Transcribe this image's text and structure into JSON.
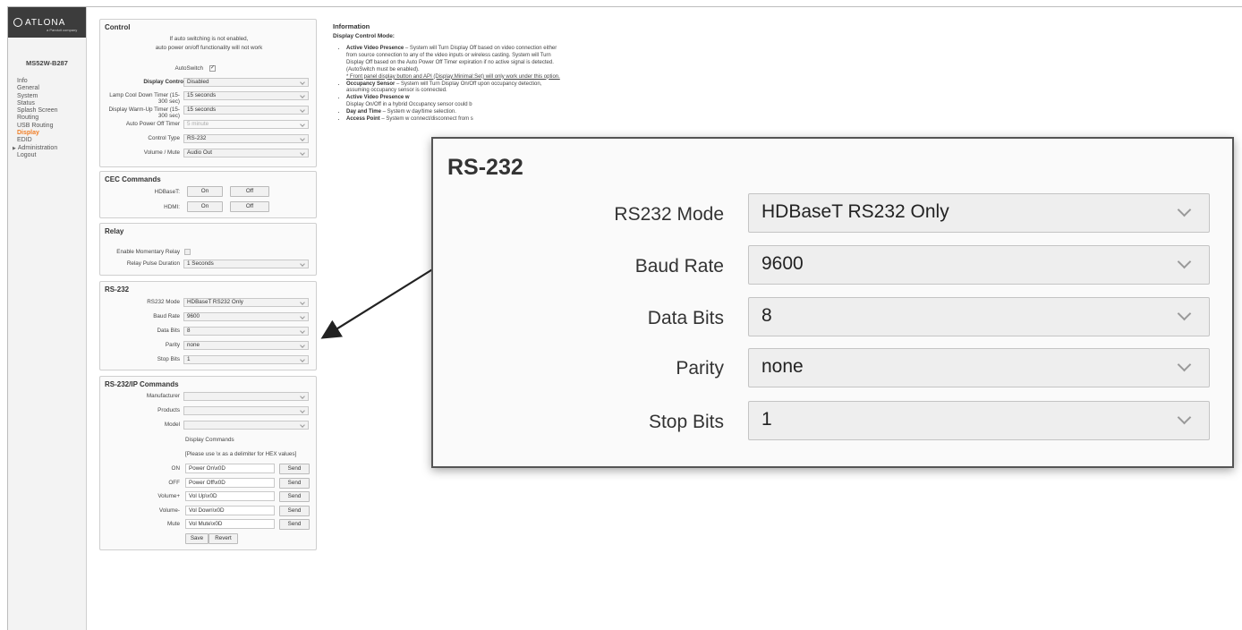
{
  "brand": {
    "logo": "ATLONA",
    "tagline": "a Panduit company"
  },
  "sidebar": {
    "model": "MS52W-B287",
    "items": [
      {
        "label": "Info"
      },
      {
        "label": "General"
      },
      {
        "label": "System"
      },
      {
        "label": "Status"
      },
      {
        "label": "Splash Screen"
      },
      {
        "label": "Routing"
      },
      {
        "label": "USB Routing"
      },
      {
        "label": "Display",
        "active": true
      },
      {
        "label": "EDID"
      },
      {
        "label": "Administration",
        "arrow": true
      },
      {
        "label": "Logout"
      }
    ]
  },
  "control": {
    "title": "Control",
    "warning_line1": "If auto switching is not enabled,",
    "warning_line2": "auto power on/off functionality will not work",
    "autoswitch_label": "AutoSwitch",
    "autoswitch_checked": "✓",
    "method_label": "Display Control Method",
    "method_value": "Disabled",
    "cooldown_label": "Lamp Cool Down Timer (15-300 sec)",
    "cooldown_value": "15 seconds",
    "warmup_label": "Display Warm-Up Timer (15-300 sec)",
    "warmup_value": "15 seconds",
    "poweroff_label": "Auto Power Off Timer",
    "poweroff_value": "5 minute",
    "control_type_label": "Control Type",
    "control_type_value": "RS-232",
    "volume_label": "Volume / Mute",
    "volume_value": "Audio Out"
  },
  "cec": {
    "title": "CEC Commands",
    "hdbaset_label": "HDBaseT:",
    "hdmi_label": "HDMI:",
    "on_label": "On",
    "off_label": "Off"
  },
  "relay": {
    "title": "Relay",
    "momentary_label": "Enable Momentary Relay",
    "pulse_label": "Relay Pulse Duration",
    "pulse_value": "1 Seconds"
  },
  "rs232": {
    "title": "RS-232",
    "mode_label": "RS232 Mode",
    "mode_value": "HDBaseT RS232 Only",
    "baud_label": "Baud Rate",
    "baud_value": "9600",
    "databits_label": "Data Bits",
    "databits_value": "8",
    "parity_label": "Parity",
    "parity_value": "none",
    "stopbits_label": "Stop Bits",
    "stopbits_value": "1"
  },
  "ipcmd": {
    "title": "RS-232/IP Commands",
    "manufacturer_label": "Manufacturer",
    "products_label": "Products",
    "model_label": "Model",
    "display_commands": "Display Commands",
    "hex_hint": "[Please use \\x as a delimiter for HEX values]",
    "send_label": "Send",
    "rows": [
      {
        "label": "ON",
        "value": "Power On\\x0D"
      },
      {
        "label": "OFF",
        "value": "Power Off\\x0D"
      },
      {
        "label": "Volume+",
        "value": "Vol Up\\x0D"
      },
      {
        "label": "Volume-",
        "value": "Vol Down\\x0D"
      },
      {
        "label": "Mute",
        "value": "Vol Mute\\x0D"
      }
    ],
    "save_label": "Save",
    "revert_label": "Revert"
  },
  "info": {
    "title": "Information",
    "subtitle": "Display Control Mode:",
    "b1_title": "Active Video Presence",
    "b1_text": " – System will Turn Display Off based on video connection either from source connection to any of the video inputs or wireless casting. System will Turn Display Off based on the Auto Power Off Timer expiration if no active signal is detected. (AutoSwitch must be enabled).",
    "b1_note": "* Front panel display button and API (Display:Minimal:Set) will only work under this option.",
    "b2_title": "Occupancy Sensor",
    "b2_text": " – System will Turn Display On/Off upon occupancy detection, assuming occupancy sensor is connected.",
    "b3_title": "Active Video Presence w",
    "b3_text": "Display On/Off in a hybrid Occupancy sensor could b",
    "b4_title": "Day and Time",
    "b4_text": " – System w day/time selection.",
    "b5_title": "Access Point",
    "b5_text": " – System w connect/disconnect from s"
  }
}
